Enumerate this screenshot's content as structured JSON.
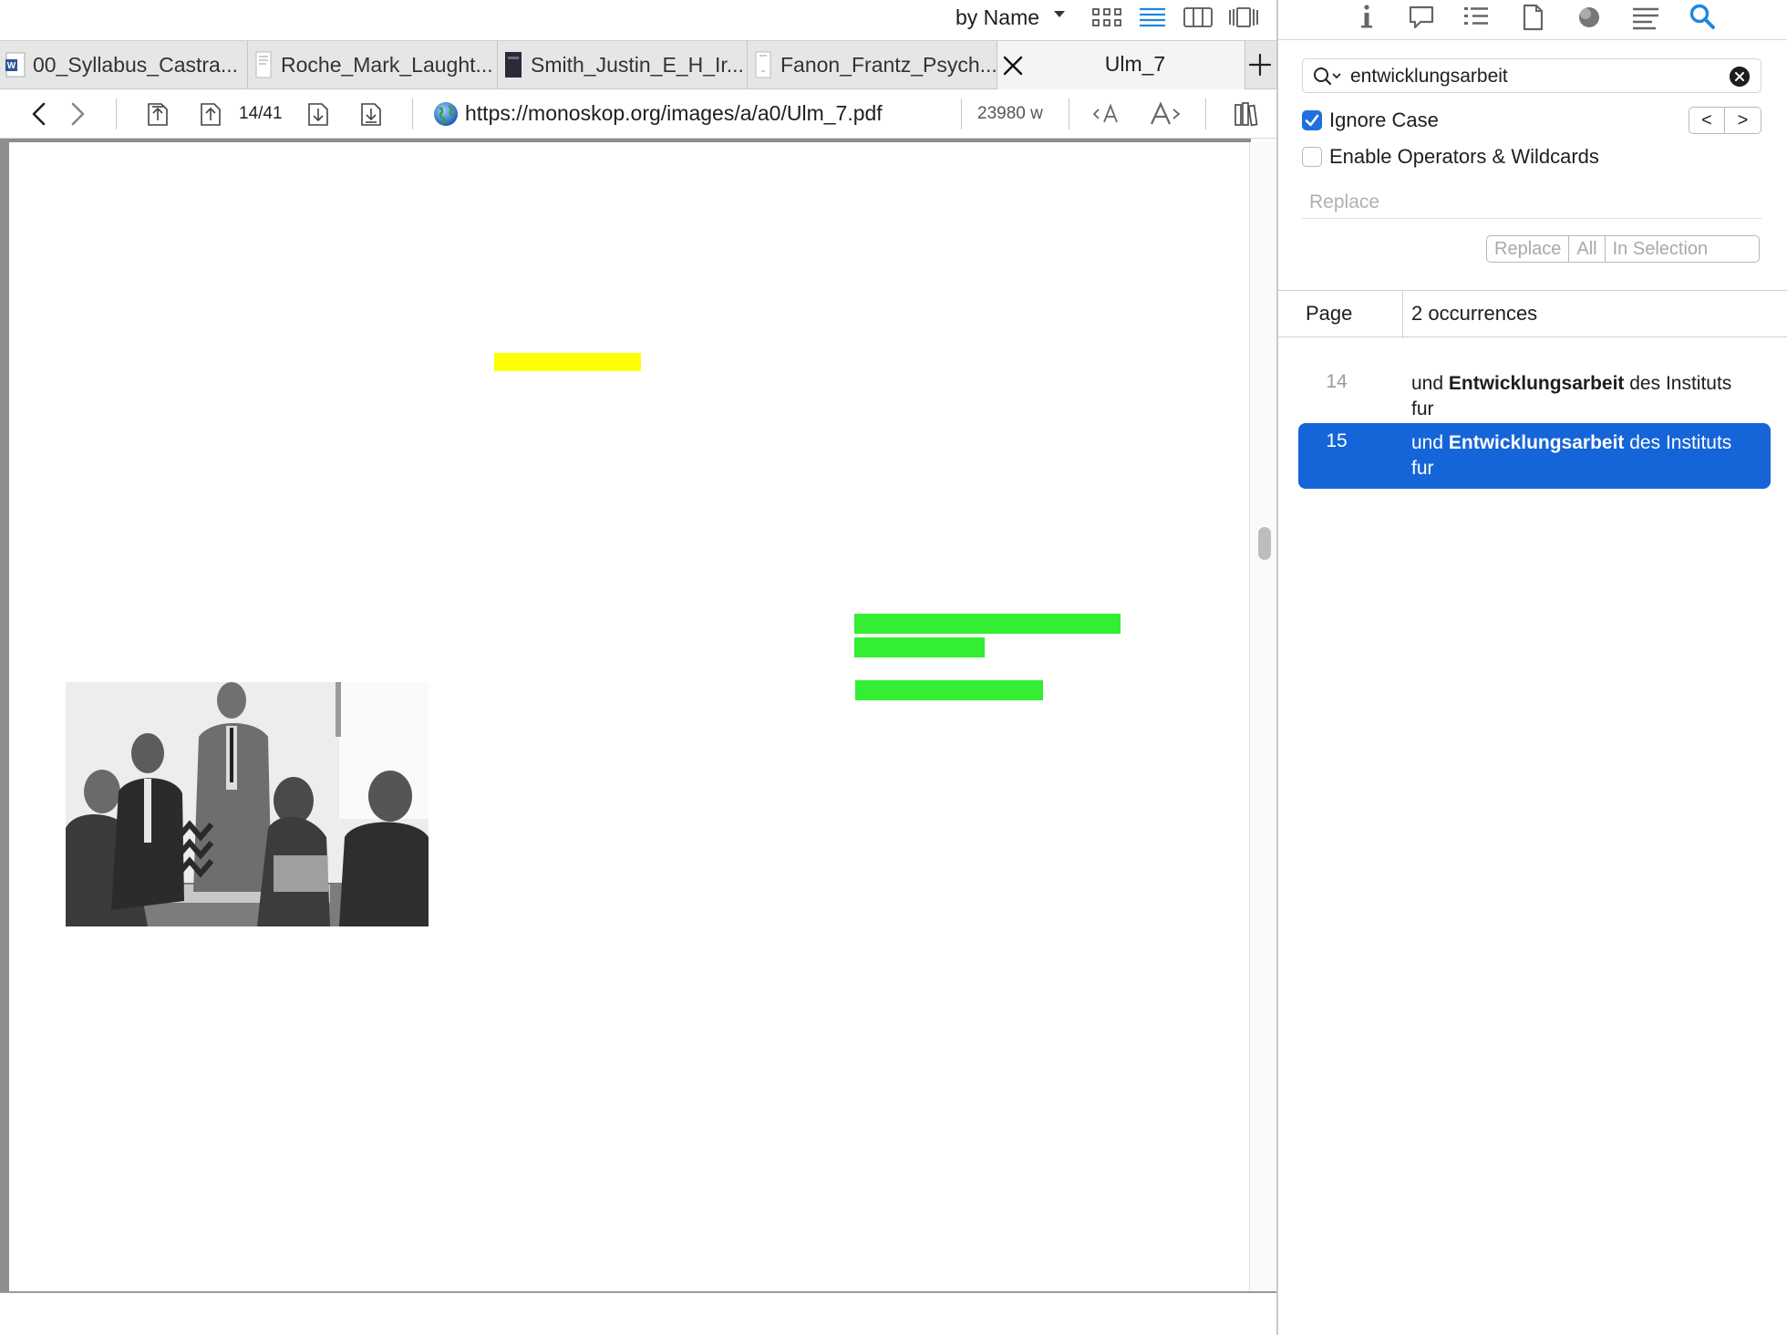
{
  "topbar": {
    "sort_label": "by Name"
  },
  "tabs": [
    {
      "label": "00_Syllabus_Castra...",
      "icon": "word-doc-icon"
    },
    {
      "label": "Roche_Mark_Laught...",
      "icon": "pdf-thumb-icon"
    },
    {
      "label": "Smith_Justin_E_H_Ir...",
      "icon": "dark-book-icon"
    },
    {
      "label": "Fanon_Frantz_Psych...",
      "icon": "pdf-thumb-icon"
    }
  ],
  "active_tab": {
    "label": "Ulm_7"
  },
  "toolbar": {
    "page_indicator": "14/41",
    "url": "https://monoskop.org/images/a/a0/Ulm_7.pdf",
    "word_count": "23980 w"
  },
  "document": {
    "highlight_colors": {
      "search_hit": "#ffff00",
      "annotation": "#33ee33"
    },
    "photo": "black-and-white photo of people gathered around a table"
  },
  "search": {
    "query": "entwicklungsarbeit",
    "ignore_case_label": "Ignore Case",
    "ignore_case_checked": true,
    "operators_label": "Enable Operators & Wildcards",
    "operators_checked": false,
    "prev_label": "<",
    "next_label": ">",
    "replace_placeholder": "Replace",
    "replace_buttons": [
      "Replace",
      "All",
      "In Selection"
    ]
  },
  "results": {
    "header_page": "Page",
    "header_count": "2 occurrences",
    "items": [
      {
        "page": "14",
        "before": "und ",
        "match": "Entwicklungsarbeit",
        "after": " des Instituts fur",
        "selected": false
      },
      {
        "page": "15",
        "before": "und ",
        "match": "Entwicklungsarbeit",
        "after": " des Instituts fur",
        "selected": true
      }
    ]
  },
  "colors": {
    "accent": "#1f6fe0",
    "selection": "#1565d8"
  }
}
